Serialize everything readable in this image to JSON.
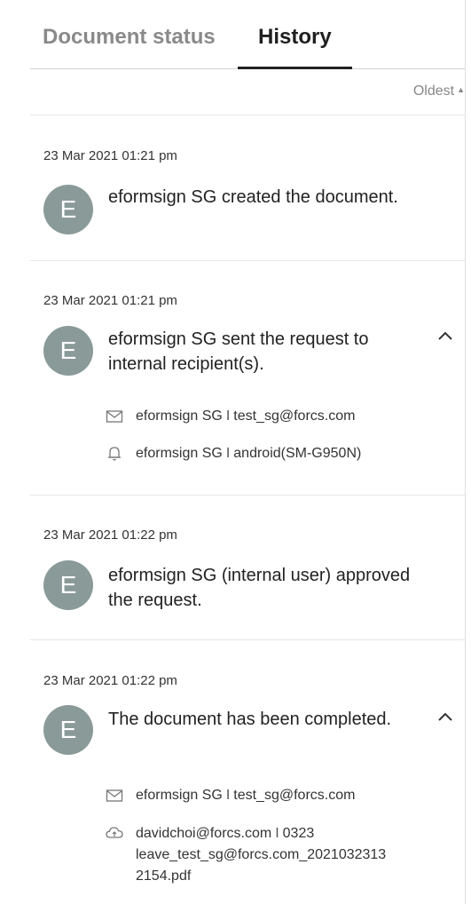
{
  "tabs": {
    "status_label": "Document status",
    "history_label": "History",
    "active": "History"
  },
  "sort": {
    "label": "Oldest"
  },
  "entries": [
    {
      "timestamp": "23 Mar 2021 01:21 pm",
      "avatar_letter": "E",
      "message": "eformsign SG created the document."
    },
    {
      "timestamp": "23 Mar 2021 01:21 pm",
      "avatar_letter": "E",
      "message": "eformsign SG sent the request to internal recipient(s).",
      "details": [
        {
          "icon": "mail-icon",
          "name": "eformsign SG",
          "separator": "I",
          "value": "test_sg@forcs.com"
        },
        {
          "icon": "bell-icon",
          "name": "eformsign SG",
          "separator": "I",
          "value": "android(SM-G950N)"
        }
      ]
    },
    {
      "timestamp": "23 Mar 2021 01:22 pm",
      "avatar_letter": "E",
      "message": "eformsign SG (internal user) approved the request."
    },
    {
      "timestamp": "23 Mar 2021 01:22 pm",
      "avatar_letter": "E",
      "message": "The document has been completed.",
      "details": [
        {
          "icon": "mail-icon",
          "name": "eformsign SG",
          "separator": "I",
          "value": "test_sg@forcs.com"
        },
        {
          "icon": "cloud-icon",
          "name": "davidchoi@forcs.com",
          "separator": "I",
          "value": "0323",
          "value_line2": "leave_test_sg@forcs.com_2021032313",
          "value_line3": "2154.pdf"
        }
      ]
    }
  ],
  "colors": {
    "avatar": "#8a9a99",
    "active_tab": "#1f1f1f",
    "inactive_tab": "#8a8a8a",
    "divider": "#e6e6e6"
  }
}
